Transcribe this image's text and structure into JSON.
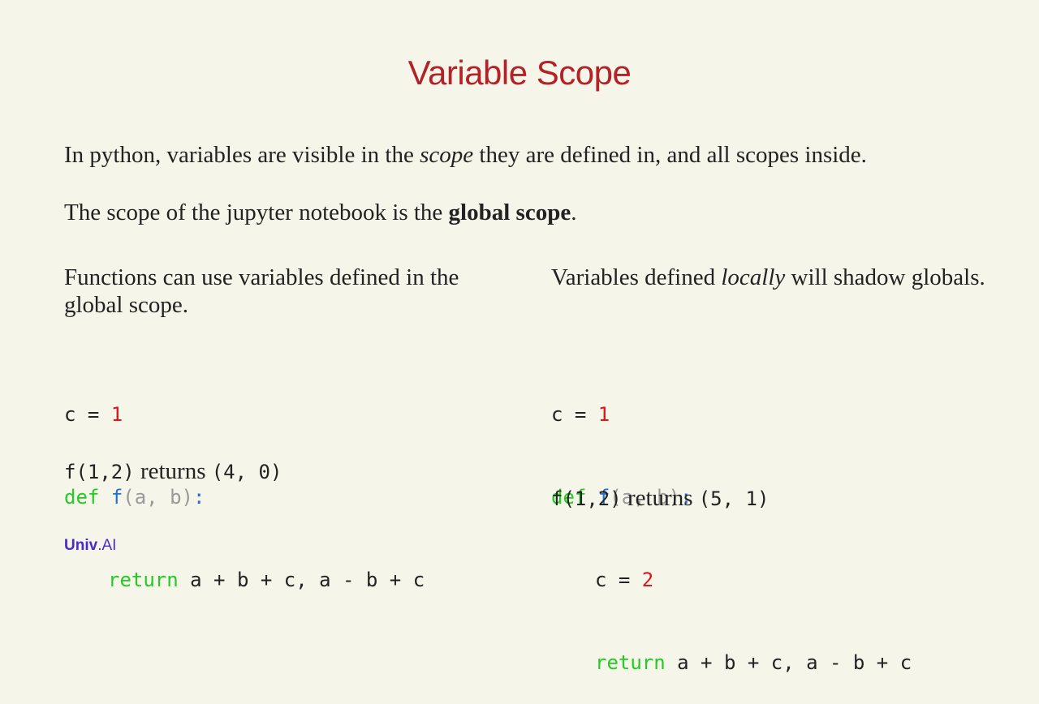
{
  "slide": {
    "title": "Variable Scope",
    "intro": {
      "part1": "In python, variables are visible in the ",
      "scope_word": "scope",
      "part2": " they are defined in, and all scopes inside."
    },
    "global": {
      "part1": "The scope of the jupyter notebook is the ",
      "bold": "global scope",
      "part2": "."
    },
    "left": {
      "text": "Functions can use variables defined in the global scope.",
      "code": {
        "l1_var": "c = ",
        "l1_num": "1",
        "l2_def": "def",
        "l2_fn": "f",
        "l2_args": "(a, b)",
        "l2_colon": ":",
        "l3_return": "return",
        "l3_expr": " a + b + c, a - b + c"
      },
      "result": {
        "call": "f(1,2)",
        "word": " returns ",
        "value": "(4, 0)"
      }
    },
    "right": {
      "text_part1": "Variables defined ",
      "text_italic": "locally",
      "text_part2": " will shadow globals.",
      "code": {
        "l1_var": "c = ",
        "l1_num": "1",
        "l2_def": "def",
        "l2_fn": "f",
        "l2_args": "(a, b)",
        "l2_colon": ":",
        "l3_var": "c = ",
        "l3_num": "2",
        "l4_return": "return",
        "l4_expr": " a + b + c, a - b + c"
      },
      "result": {
        "call": "f(1,2)",
        "word": " returns ",
        "value": "(5, 1)"
      }
    },
    "logo": {
      "bold": "Univ",
      "rest": ".AI"
    }
  }
}
